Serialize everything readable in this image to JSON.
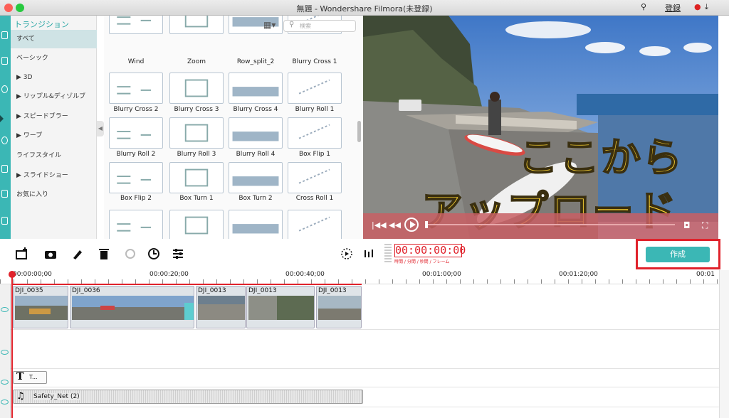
{
  "window": {
    "title": "無題 - Wondershare Filmora(未登録)",
    "login": "登録"
  },
  "categories": {
    "heading": "トランジション",
    "items": [
      "すべて",
      "ベーシック",
      "▶ 3D",
      "▶ リップル&ディゾルブ",
      "▶ スピードブラー",
      "▶ ワープ",
      "ライフスタイル",
      "▶ スライドショー",
      "お気に入り"
    ]
  },
  "search": {
    "placeholder": "検索"
  },
  "transitions": [
    "Wind",
    "Zoom",
    "Row_split_2",
    "Blurry Cross 1",
    "Blurry Cross 2",
    "Blurry Cross 3",
    "Blurry Cross 4",
    "Blurry Roll 1",
    "Blurry Roll 2",
    "Blurry Roll 3",
    "Blurry Roll 4",
    "Box Flip 1",
    "Box Flip 2",
    "Box Turn 1",
    "Box Turn 2",
    "Cross Roll 1"
  ],
  "overlay": {
    "line1": "ここから",
    "line2": "アップロード"
  },
  "timecode": {
    "value": "00:00:00:00",
    "caption": "時間 / 分間 / 秒間 / フレーム"
  },
  "create_button": "作成",
  "ruler": [
    "00:00:00;00",
    "00:00:20;00",
    "00:00:40;00",
    "00:01:00;00",
    "00:01:20;00",
    "00:01"
  ],
  "clips": [
    "DJI_0035",
    "DJI_0036",
    "DJI_0013",
    "DJI_0013",
    "DJI_0013"
  ],
  "text_track": {
    "label": "T..."
  },
  "audio_track": {
    "label": "Safety_Net (2)"
  },
  "colors": {
    "accent": "#3bb7b5",
    "highlight": "#e0222b",
    "overlay_text": "#fbd334"
  }
}
